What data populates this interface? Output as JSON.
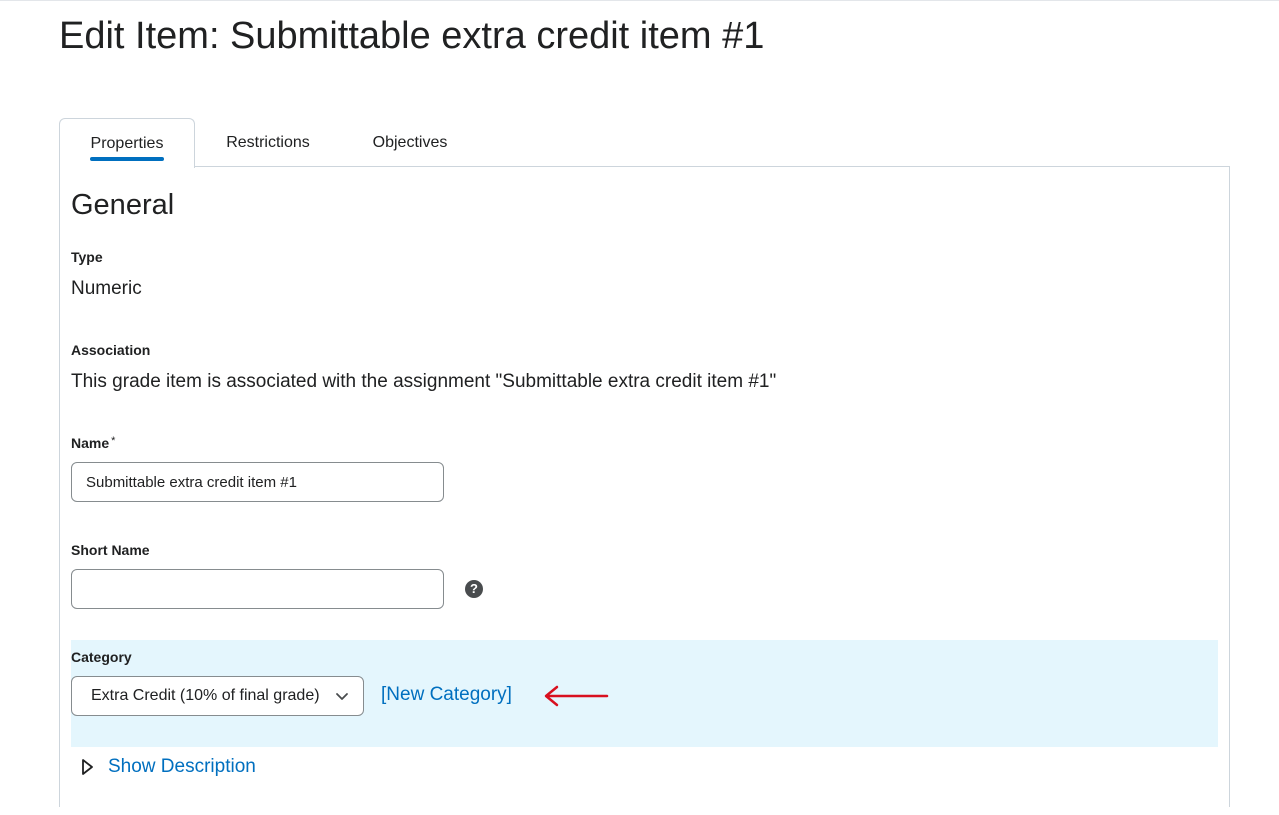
{
  "page": {
    "title": "Edit Item: Submittable extra credit item #1"
  },
  "tabs": [
    {
      "label": "Properties",
      "active": true
    },
    {
      "label": "Restrictions",
      "active": false
    },
    {
      "label": "Objectives",
      "active": false
    }
  ],
  "general": {
    "heading": "General",
    "type_label": "Type",
    "type_value": "Numeric",
    "association_label": "Association",
    "association_value": "This grade item is associated with the assignment \"Submittable extra credit item #1\"",
    "name_label": "Name",
    "name_required_mark": "*",
    "name_value": "Submittable extra credit item #1",
    "short_name_label": "Short Name",
    "short_name_value": "",
    "help_glyph": "?",
    "category_label": "Category",
    "category_selected": "Extra Credit (10% of final grade)",
    "new_category_link": "[New Category]",
    "show_description_link": "Show Description"
  },
  "icons": {
    "help": "question-circle-icon",
    "select_chevron": "chevron-down-icon",
    "annotation_arrow": "red-arrow-left-icon",
    "expand": "triangle-right-icon"
  },
  "colors": {
    "link": "#006fbf",
    "active_tab_underline": "#006fbf",
    "category_highlight": "#e4f6fd",
    "annotation_arrow": "#d8101f",
    "text": "#202122"
  }
}
